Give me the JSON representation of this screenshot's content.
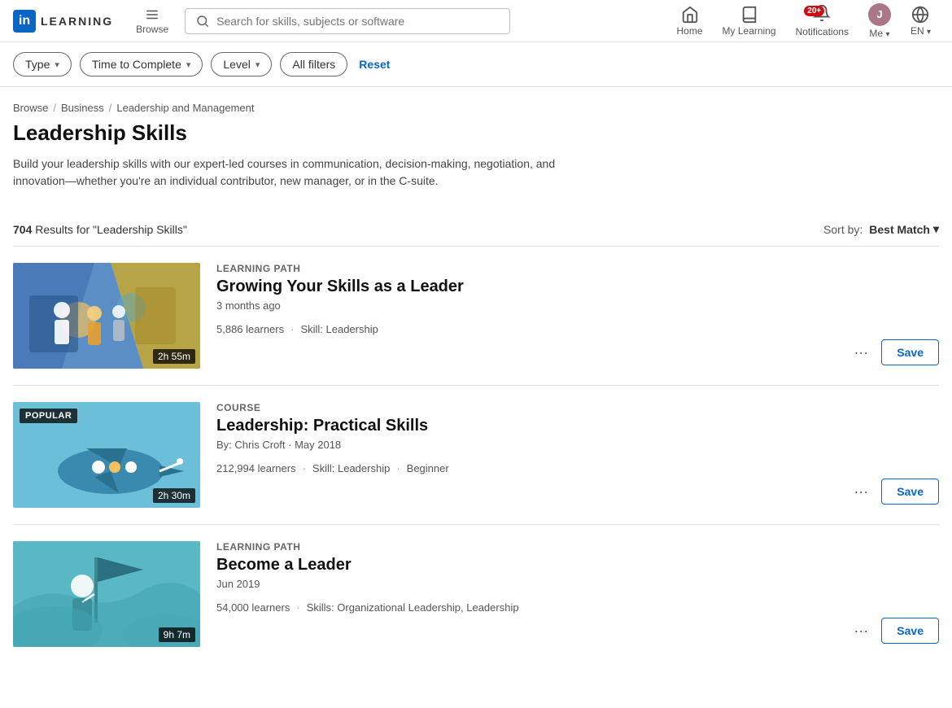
{
  "header": {
    "logo_text": "LEARNING",
    "logo_short": "in",
    "browse_label": "Browse",
    "search_placeholder": "Search for skills, subjects or software",
    "nav": [
      {
        "id": "home",
        "label": "Home",
        "icon": "home-icon"
      },
      {
        "id": "my-learning",
        "label": "My Learning",
        "icon": "book-icon"
      },
      {
        "id": "notifications",
        "label": "Notifications",
        "icon": "bell-icon",
        "badge": "20+"
      },
      {
        "id": "me",
        "label": "Me",
        "icon": "avatar-icon",
        "has_chevron": true
      },
      {
        "id": "language",
        "label": "EN",
        "icon": "globe-icon",
        "has_chevron": true
      }
    ]
  },
  "filters": {
    "items": [
      {
        "id": "type",
        "label": "Type"
      },
      {
        "id": "time-to-complete",
        "label": "Time to Complete"
      },
      {
        "id": "level",
        "label": "Level"
      },
      {
        "id": "all-filters",
        "label": "All filters"
      }
    ],
    "reset_label": "Reset"
  },
  "breadcrumb": {
    "items": [
      "Browse",
      "Business",
      "Leadership and Management"
    ]
  },
  "page": {
    "title": "Leadership Skills",
    "description": "Build your leadership skills with our expert-led courses in communication, decision-making, negotiation, and innovation—whether you're an individual contributor, new manager, or in the C-suite."
  },
  "results": {
    "count": "704",
    "query": "Leadership Skills",
    "sort_label": "Sort by:",
    "sort_value": "Best Match"
  },
  "courses": [
    {
      "id": 1,
      "type": "LEARNING PATH",
      "title": "Growing Your Skills as a Leader",
      "meta": "3 months ago",
      "duration": "2h 55m",
      "learners": "5,886 learners",
      "skill": "Skill: Leadership",
      "badge": null,
      "thumb_style": "thumb-1"
    },
    {
      "id": 2,
      "type": "COURSE",
      "title": "Leadership: Practical Skills",
      "meta": "By: Chris Croft  ·  May 2018",
      "duration": "2h 30m",
      "learners": "212,994 learners",
      "skill": "Skill: Leadership",
      "level": "Beginner",
      "badge": "POPULAR",
      "thumb_style": "thumb-2"
    },
    {
      "id": 3,
      "type": "LEARNING PATH",
      "title": "Become a Leader",
      "meta": "Jun 2019",
      "duration": "9h 7m",
      "learners": "54,000 learners",
      "skill": "Skills: Organizational Leadership, Leadership",
      "badge": null,
      "thumb_style": "thumb-3"
    }
  ],
  "actions": {
    "save_label": "Save",
    "more_label": "···"
  }
}
